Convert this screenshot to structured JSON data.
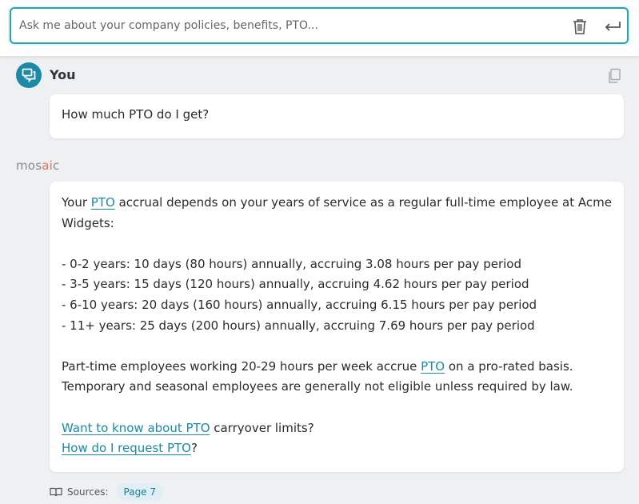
{
  "search": {
    "placeholder": "Ask me about your company policies, benefits, PTO...",
    "value": ""
  },
  "user": {
    "name": "You",
    "question": "How much PTO do I get?"
  },
  "brand": {
    "prefix": "mos",
    "accent": "ai",
    "suffix": "c"
  },
  "answer": {
    "intro_before": "Your ",
    "intro_link": "PTO",
    "intro_after": " accrual depends on your years of service as a regular full-time employee at Acme Widgets:",
    "tiers": [
      "- 0-2 years: 10 days (80 hours) annually, accruing 3.08 hours per pay period",
      "- 3-5 years: 15 days (120 hours) annually, accruing 4.62 hours per pay period",
      "- 6-10 years: 20 days (160 hours) annually, accruing 6.15 hours per pay period",
      "- 11+ years: 25 days (200 hours) annually, accruing 7.69 hours per pay period"
    ],
    "parttime_before": "Part-time employees working 20-29 hours per week accrue ",
    "parttime_link": "PTO",
    "parttime_after": " on a pro-rated basis.",
    "temporary": "Temporary and seasonal employees are generally not eligible unless required by law.",
    "followup1_link": "Want to know about PTO",
    "followup1_after": " carryover limits?",
    "followup2_link": "How do I request PTO",
    "followup2_after": "?"
  },
  "sources": {
    "label": "Sources:",
    "page": "Page 7"
  },
  "colors": {
    "accent": "#1a8aa6",
    "focus_border": "#27a3b8",
    "brand_accent": "#e8735a"
  },
  "icons": {
    "trash": "trash-icon",
    "enter": "enter-icon",
    "chat": "chat-icon",
    "copy": "copy-icon",
    "book": "book-icon"
  }
}
